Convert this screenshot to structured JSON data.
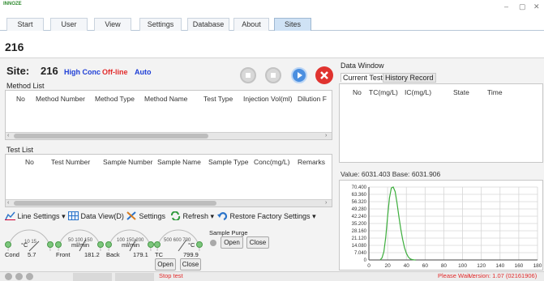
{
  "app": {
    "logo": "INNOZE",
    "window_controls": [
      "–",
      "▢",
      "✕"
    ]
  },
  "tabs": [
    {
      "label": "Start"
    },
    {
      "label": "User"
    },
    {
      "label": "View"
    },
    {
      "label": "Settings"
    },
    {
      "label": "Database"
    },
    {
      "label": "About"
    },
    {
      "label": "Sites",
      "active": true
    }
  ],
  "header": {
    "site_id": "216"
  },
  "site": {
    "prefix": "Site:",
    "number": "216",
    "conc": "High Conc",
    "conc_color": "#1f3fd6",
    "online": "Off-line",
    "online_color": "#e22b2b",
    "mode": "Auto",
    "mode_color": "#1f3fd6"
  },
  "method_list": {
    "title": "Method List",
    "columns": [
      "No",
      "Method Number",
      "Method Type",
      "Method Name",
      "Test Type",
      "Injection Vol(ml)",
      "Dilution F"
    ]
  },
  "test_list": {
    "title": "Test List",
    "columns": [
      "No",
      "Test Number",
      "Sample Number",
      "Sample Name",
      "Sample Type",
      "Conc(mg/L)",
      "Remarks"
    ]
  },
  "toolbar": {
    "line_settings": "Line Settings",
    "data_view": "Data View(D)",
    "settings": "Settings",
    "refresh": "Refresh",
    "restore": "Restore Factory Settings",
    "dropdown_marker": "▾"
  },
  "gauges": {
    "cond": {
      "label": "Cond",
      "value": "5.7",
      "unit": "°C"
    },
    "front": {
      "label": "Front",
      "value": "181.2",
      "unit": "ml/min"
    },
    "back": {
      "label": "Back",
      "value": "179.1",
      "unit": "ml/min"
    },
    "tc": {
      "label": "TC",
      "value": "799.9",
      "unit": "°C"
    },
    "tc_open": "Open",
    "tc_close": "Close"
  },
  "purge": {
    "title": "Sample Purge",
    "open": "Open",
    "close": "Close"
  },
  "data_window": {
    "title": "Data Window",
    "tabs": [
      "Current Test",
      "History Record"
    ],
    "columns": [
      "No",
      "TC(mg/L)",
      "IC(mg/L)",
      "State",
      "Time"
    ]
  },
  "chart_info": {
    "value_label": "Value:",
    "value": "6031.403",
    "base_label": "Base:",
    "base": "6031.906"
  },
  "chart_data": {
    "type": "line",
    "title": "",
    "xlabel": "",
    "ylabel": "",
    "xlim": [
      0,
      180
    ],
    "ylim": [
      0,
      70400
    ],
    "x_ticks": [
      0,
      20,
      40,
      60,
      80,
      100,
      120,
      140,
      160,
      180
    ],
    "y_ticks": [
      "70.400",
      "63.360",
      "56.320",
      "49.280",
      "42.240",
      "35.200",
      "28.160",
      "21.120",
      "14.080",
      "7.040",
      "0"
    ],
    "y_tick_values": [
      70400,
      63360,
      56320,
      49280,
      42240,
      35200,
      28160,
      21120,
      14080,
      7040,
      0
    ],
    "grid": true,
    "series": [
      {
        "color": "#3cae3c",
        "x": [
          12,
          14,
          16,
          18,
          20,
          22,
          24,
          26,
          28,
          30,
          32,
          34,
          36,
          38,
          40,
          42,
          44,
          46,
          48,
          50
        ],
        "y": [
          0,
          2000,
          8000,
          22000,
          42000,
          60000,
          69500,
          70400,
          66000,
          55000,
          42000,
          30000,
          20000,
          12000,
          6500,
          3000,
          1200,
          400,
          100,
          0
        ]
      }
    ]
  },
  "status": {
    "stop": "Stop test",
    "wait": "Please Wait...",
    "version": "Version: 1.07 (02161906)"
  }
}
